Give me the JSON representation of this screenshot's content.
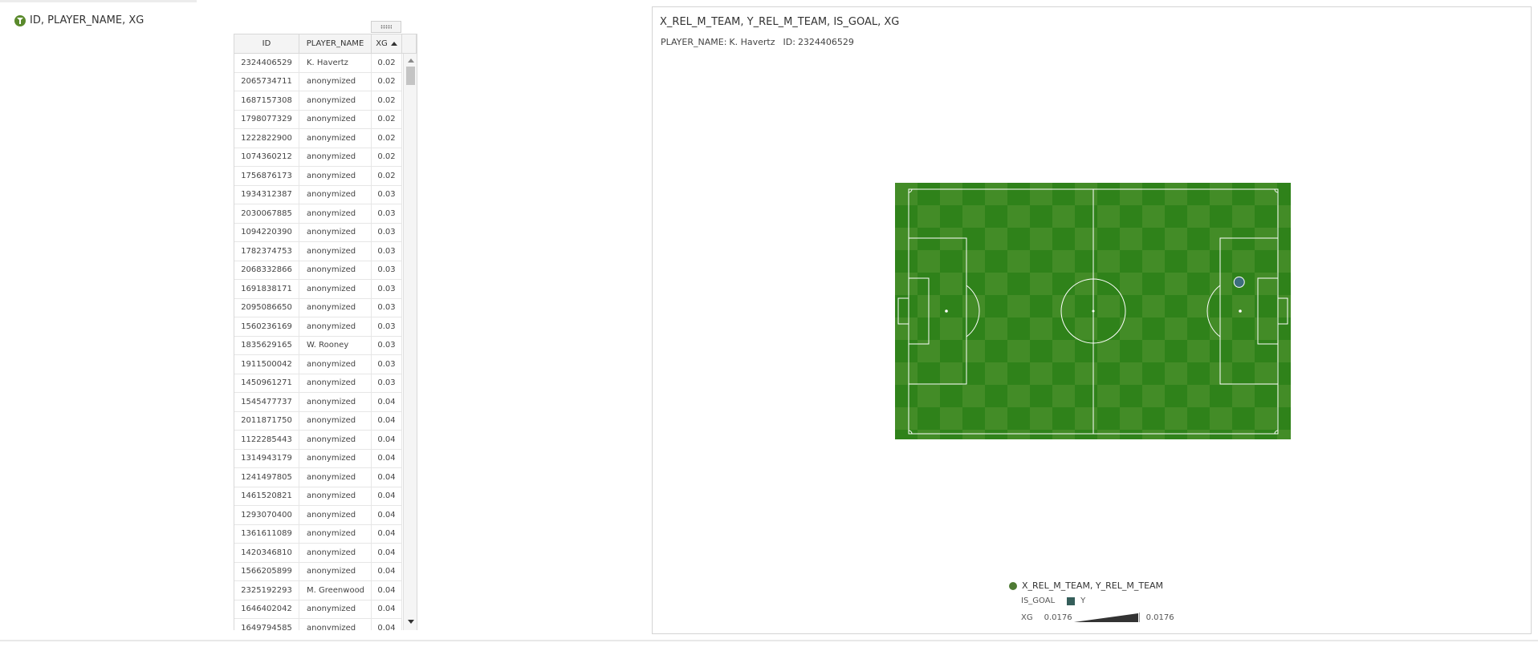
{
  "left_panel": {
    "title": "ID, PLAYER_NAME, XG",
    "filter_icon": "filter-icon",
    "drag_handle_icon": "grip-dots-icon",
    "columns": [
      "ID",
      "PLAYER_NAME",
      "XG"
    ],
    "sort": "ascending",
    "rows": [
      [
        "2324406529",
        "K. Havertz",
        "0.02"
      ],
      [
        "2065734711",
        "anonymized",
        "0.02"
      ],
      [
        "1687157308",
        "anonymized",
        "0.02"
      ],
      [
        "1798077329",
        "anonymized",
        "0.02"
      ],
      [
        "1222822900",
        "anonymized",
        "0.02"
      ],
      [
        "1074360212",
        "anonymized",
        "0.02"
      ],
      [
        "1756876173",
        "anonymized",
        "0.02"
      ],
      [
        "1934312387",
        "anonymized",
        "0.03"
      ],
      [
        "2030067885",
        "anonymized",
        "0.03"
      ],
      [
        "1094220390",
        "anonymized",
        "0.03"
      ],
      [
        "1782374753",
        "anonymized",
        "0.03"
      ],
      [
        "2068332866",
        "anonymized",
        "0.03"
      ],
      [
        "1691838171",
        "anonymized",
        "0.03"
      ],
      [
        "2095086650",
        "anonymized",
        "0.03"
      ],
      [
        "1560236169",
        "anonymized",
        "0.03"
      ],
      [
        "1835629165",
        "W. Rooney",
        "0.03"
      ],
      [
        "1911500042",
        "anonymized",
        "0.03"
      ],
      [
        "1450961271",
        "anonymized",
        "0.03"
      ],
      [
        "1545477737",
        "anonymized",
        "0.04"
      ],
      [
        "2011871750",
        "anonymized",
        "0.04"
      ],
      [
        "1122285443",
        "anonymized",
        "0.04"
      ],
      [
        "1314943179",
        "anonymized",
        "0.04"
      ],
      [
        "1241497805",
        "anonymized",
        "0.04"
      ],
      [
        "1461520821",
        "anonymized",
        "0.04"
      ],
      [
        "1293070400",
        "anonymized",
        "0.04"
      ],
      [
        "1361611089",
        "anonymized",
        "0.04"
      ],
      [
        "1420346810",
        "anonymized",
        "0.04"
      ],
      [
        "1566205899",
        "anonymized",
        "0.04"
      ],
      [
        "2325192293",
        "M. Greenwood",
        "0.04"
      ],
      [
        "1646402042",
        "anonymized",
        "0.04"
      ],
      [
        "1649794585",
        "anonymized",
        "0.04"
      ]
    ]
  },
  "right_panel": {
    "title": "X_REL_M_TEAM, Y_REL_M_TEAM, IS_GOAL, XG",
    "info": {
      "player_label": "PLAYER_NAME:",
      "player_value": "K. Havertz",
      "id_label": "ID:",
      "id_value": "2324406529"
    },
    "shot": {
      "x_rel_m_team": 0.895,
      "y_rel_m_team": 0.38,
      "is_goal": "Y",
      "xg": 0.0176
    },
    "legend": {
      "series_label": "X_REL_M_TEAM, Y_REL_M_TEAM",
      "is_goal_label": "IS_GOAL",
      "is_goal_value": "Y",
      "xg_label": "XG",
      "xg_min": "0.0176",
      "xg_max": "0.0176"
    }
  },
  "colors": {
    "pitch_green": "#2f821a",
    "pitch_stripe": "#4f9430",
    "shot_marker": "#3d6e7e",
    "legend_dot": "#4e7a34",
    "legend_square": "#355e5a",
    "filter_icon": "#5a8a2c"
  }
}
